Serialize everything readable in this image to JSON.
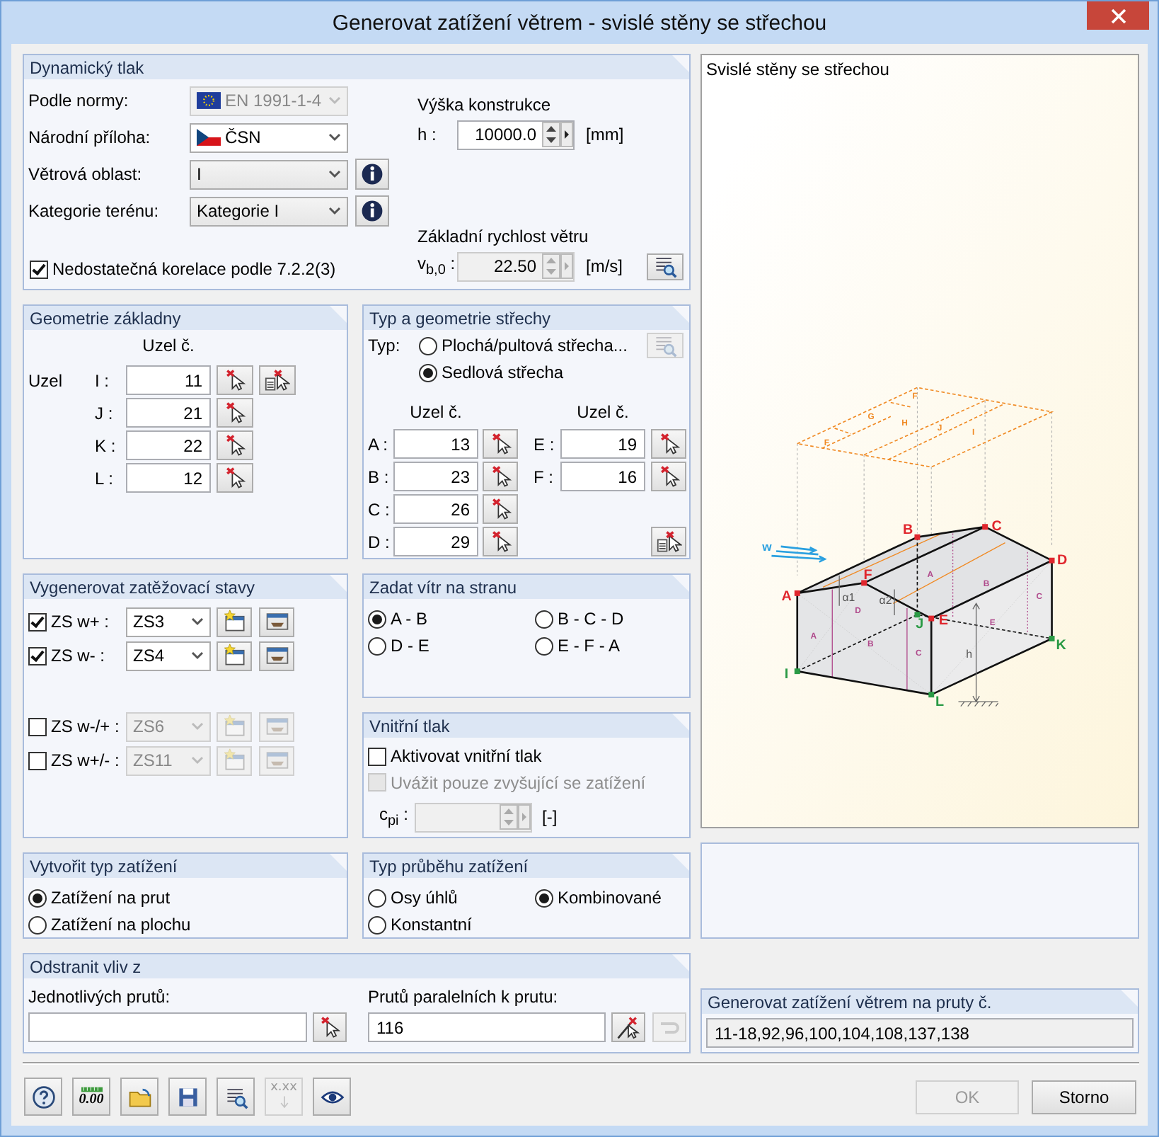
{
  "window": {
    "title": "Generovat zatížení větrem - svislé stěny se střechou"
  },
  "dynamic_pressure": {
    "title": "Dynamický tlak",
    "selectors": [
      {
        "label": "Podle normy:",
        "value": "EN 1991-1-4",
        "disabled": true,
        "info": false
      },
      {
        "label": "Národní příloha:",
        "value": "ČSN",
        "disabled": false,
        "info": false
      },
      {
        "label": "Větrová oblast:",
        "value": "I",
        "disabled": false,
        "info": true
      },
      {
        "label": "Kategorie terénu:",
        "value": "Kategorie I",
        "disabled": false,
        "info": true
      }
    ],
    "correlation": {
      "label": "Nedostatečná korelace podle 7.2.2(3)",
      "checked": true
    },
    "height": {
      "title": "Výška konstrukce",
      "symbol": "h :",
      "value": "10000.0",
      "unit": "[mm]",
      "disabled": false
    },
    "wind_speed": {
      "title": "Základní rychlost větru",
      "symbol": "v$_{b,0}$ :",
      "value": "22.50",
      "unit": "[m/s]",
      "disabled": true
    },
    "details_button": {
      "disabled": false
    }
  },
  "base_geometry": {
    "title": "Geometrie základny",
    "column_header": "Uzel č.",
    "row_label": "Uzel",
    "nodes": [
      {
        "label": "I :",
        "value": "11"
      },
      {
        "label": "J :",
        "value": "21"
      },
      {
        "label": "K :",
        "value": "22"
      },
      {
        "label": "L :",
        "value": "12"
      }
    ]
  },
  "roof": {
    "title": "Typ a geometrie střechy",
    "type_label": "Typ:",
    "types": [
      {
        "label": "Plochá/pultová střecha...",
        "selected": false
      },
      {
        "label": "Sedlová střecha",
        "selected": true
      }
    ],
    "library_button": {
      "disabled": true
    },
    "columns": [
      {
        "header": "Uzel č.",
        "nodes": [
          {
            "label": "A :",
            "value": "13"
          },
          {
            "label": "B :",
            "value": "23"
          },
          {
            "label": "C :",
            "value": "26"
          },
          {
            "label": "D :",
            "value": "29"
          }
        ]
      },
      {
        "header": "Uzel č.",
        "nodes": [
          {
            "label": "E :",
            "value": "19"
          },
          {
            "label": "F :",
            "value": "16"
          }
        ]
      }
    ]
  },
  "load_cases": {
    "title": "Vygenerovat zatěžovací stavy",
    "items": [
      {
        "label": "ZS w+ :",
        "checked": true,
        "value": "ZS3"
      },
      {
        "label": "ZS w- :",
        "checked": true,
        "value": "ZS4"
      },
      {
        "label": "ZS w-/+ :",
        "checked": false,
        "value": "ZS6"
      },
      {
        "label": "ZS w+/- :",
        "checked": false,
        "value": "ZS11"
      }
    ]
  },
  "wind_side": {
    "title": "Zadat vítr na stranu",
    "options": [
      {
        "label": "A - B",
        "selected": true
      },
      {
        "label": "B - C - D",
        "selected": false
      },
      {
        "label": "D - E",
        "selected": false
      },
      {
        "label": "E - F - A",
        "selected": false
      }
    ]
  },
  "internal_pressure": {
    "title": "Vnitřní tlak",
    "activate": {
      "label": "Aktivovat vnitřní tlak",
      "checked": false
    },
    "only_increasing": {
      "label": "Uvážit pouze zvyšující se zatížení",
      "checked": false,
      "disabled": true
    },
    "cpi": {
      "symbol": "c$_{pi}$ :",
      "unit": "[-]",
      "disabled": true
    }
  },
  "load_type": {
    "title": "Vytvořit typ zatížení",
    "options": [
      {
        "label": "Zatížení na prut",
        "selected": true
      },
      {
        "label": "Zatížení na plochu",
        "selected": false
      }
    ]
  },
  "distribution": {
    "title": "Typ průběhu zatížení",
    "options": [
      {
        "label": "Osy úhlů",
        "selected": false
      },
      {
        "label": "Kombinované",
        "selected": true
      },
      {
        "label": "Konstantní",
        "selected": false
      }
    ]
  },
  "remove_influence": {
    "title": "Odstranit vliv z",
    "single": {
      "label": "Jednotlivých prutů:"
    },
    "parallel": {
      "label": "Prutů paralelních k prutu:",
      "value": "116",
      "clear_disabled": true
    }
  },
  "preview": {
    "caption": "Svislé stěny se střechou",
    "labels": [
      {
        "text": "F",
        "kind": "roof"
      },
      {
        "text": "G",
        "kind": "roof"
      },
      {
        "text": "H",
        "kind": "roof"
      },
      {
        "text": "J",
        "kind": "roof"
      },
      {
        "text": "I",
        "kind": "roof"
      },
      {
        "text": "F",
        "kind": "roof"
      },
      {
        "text": "B",
        "kind": "node"
      },
      {
        "text": "C",
        "kind": "node"
      },
      {
        "text": "w",
        "kind": "wind"
      },
      {
        "text": "D",
        "kind": "node"
      },
      {
        "text": "F",
        "kind": "node"
      },
      {
        "text": "A",
        "kind": "zone"
      },
      {
        "text": "B",
        "kind": "zone"
      },
      {
        "text": "A",
        "kind": "node"
      },
      {
        "text": "α1",
        "kind": "dimension"
      },
      {
        "text": "α2",
        "kind": "dimension"
      },
      {
        "text": "C",
        "kind": "zone"
      },
      {
        "text": "D",
        "kind": "zone"
      },
      {
        "text": "J",
        "kind": "base"
      },
      {
        "text": "E",
        "kind": "node"
      },
      {
        "text": "E",
        "kind": "zone"
      },
      {
        "text": "A",
        "kind": "zone"
      },
      {
        "text": "B",
        "kind": "zone"
      },
      {
        "text": "C",
        "kind": "zone"
      },
      {
        "text": "h",
        "kind": "dimension"
      },
      {
        "text": "K",
        "kind": "base"
      },
      {
        "text": "I",
        "kind": "base"
      },
      {
        "text": "L",
        "kind": "base"
      }
    ]
  },
  "members": {
    "title": "Generovat zatížení větrem na pruty č.",
    "value": "11-18,92,96,100,104,108,137,138"
  },
  "toolbar": [
    {
      "kind": "help",
      "disabled": false
    },
    {
      "kind": "decimals",
      "label": "0.00",
      "disabled": false
    },
    {
      "kind": "open",
      "disabled": false
    },
    {
      "kind": "save",
      "disabled": false
    },
    {
      "kind": "view",
      "disabled": false
    },
    {
      "kind": "format",
      "label": "x.xx",
      "disabled": true
    },
    {
      "kind": "eye",
      "disabled": false
    }
  ],
  "buttons": [
    {
      "label": "OK",
      "disabled": true
    },
    {
      "label": "Storno",
      "disabled": false
    }
  ]
}
